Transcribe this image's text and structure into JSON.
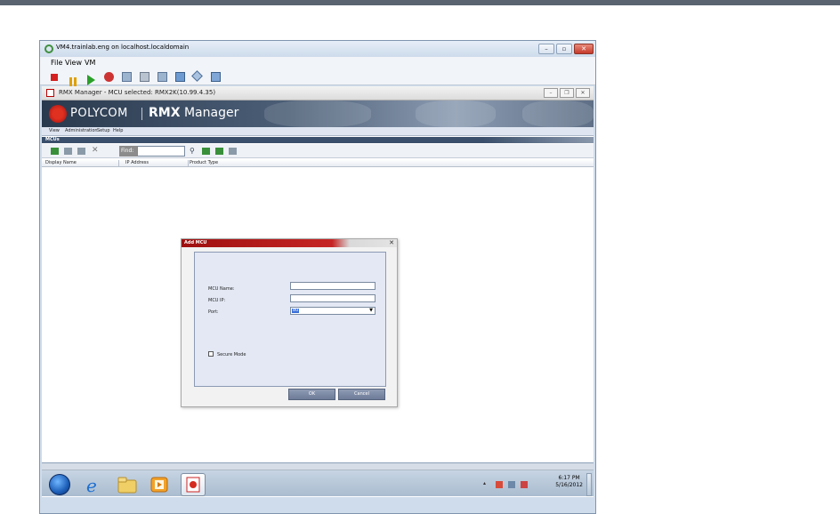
{
  "vm_window": {
    "title": "VM4.trainlab.eng on localhost.localdomain",
    "menu": [
      "File",
      "View",
      "VM"
    ]
  },
  "rmx_window": {
    "title": "RMX Manager - MCU selected: RMX2K(10.99.4.35)",
    "brand": "POLYCOM",
    "product_bold": "RMX",
    "product_rest": " Manager",
    "menu": [
      "View",
      "Administration",
      "Setup",
      "Help"
    ],
    "section_label": "MCUs",
    "find_label": "Find:",
    "columns": [
      "Display Name",
      "IP Address",
      "Product Type"
    ]
  },
  "dialog": {
    "title": "Add MCU",
    "close_glyph": "✕",
    "mcu_name_label": "MCU Name:",
    "mcu_ip_label": "MCU IP:",
    "port_label": "Port:",
    "port_value": "80",
    "secure_mode_label": "Secure Mode",
    "secure_mode_checked": false,
    "ok_label": "OK",
    "cancel_label": "Cancel"
  },
  "taskbar": {
    "time": "6:17 PM",
    "date": "5/16/2012"
  },
  "colors": {
    "polycom_red": "#e03020",
    "dialog_title_red": "#b21818",
    "accent_blue": "#3a6fd8"
  }
}
